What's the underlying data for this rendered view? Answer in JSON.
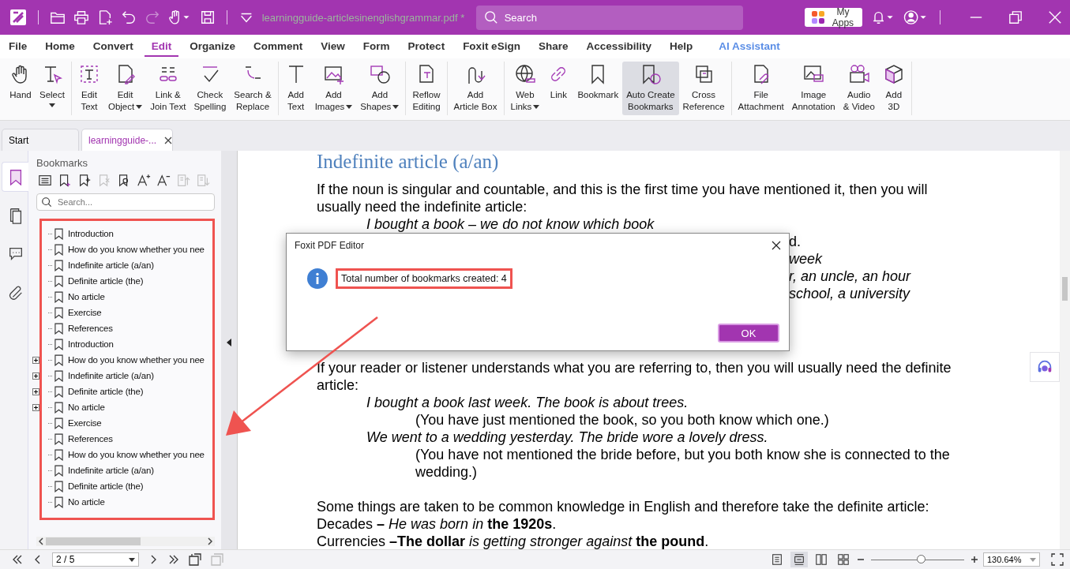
{
  "window": {
    "title": "learningguide-articlesinenglishgrammar.pdf *",
    "search_placeholder": "Search",
    "my_apps": "My Apps"
  },
  "menu": [
    {
      "label": "File",
      "selected": false
    },
    {
      "label": "Home",
      "selected": false
    },
    {
      "label": "Convert",
      "selected": false
    },
    {
      "label": "Edit",
      "selected": true
    },
    {
      "label": "Organize",
      "selected": false
    },
    {
      "label": "Comment",
      "selected": false
    },
    {
      "label": "View",
      "selected": false
    },
    {
      "label": "Form",
      "selected": false
    },
    {
      "label": "Protect",
      "selected": false
    },
    {
      "label": "Foxit eSign",
      "selected": false
    },
    {
      "label": "Share",
      "selected": false
    },
    {
      "label": "Accessibility",
      "selected": false
    },
    {
      "label": "Help",
      "selected": false
    },
    {
      "label": "AI Assistant",
      "selected": false,
      "kind": "ai"
    }
  ],
  "ribbon_groups": [
    [
      {
        "lines": [
          "Hand"
        ],
        "dropdown": false,
        "selected": false
      },
      {
        "lines": [
          "Select"
        ],
        "dropdown": true,
        "selected": false
      }
    ],
    [
      {
        "lines": [
          "Edit",
          "Text"
        ],
        "dropdown": false,
        "selected": false
      },
      {
        "lines": [
          "Edit",
          "Object"
        ],
        "dropdown": true,
        "selected": false
      },
      {
        "lines": [
          "Link &",
          "Join Text"
        ],
        "dropdown": false,
        "selected": false
      },
      {
        "lines": [
          "Check",
          "Spelling"
        ],
        "dropdown": false,
        "selected": false
      },
      {
        "lines": [
          "Search &",
          "Replace"
        ],
        "dropdown": false,
        "selected": false
      }
    ],
    [
      {
        "lines": [
          "Add",
          "Text"
        ],
        "dropdown": false,
        "selected": false
      },
      {
        "lines": [
          "Add",
          "Images"
        ],
        "dropdown": true,
        "selected": false
      },
      {
        "lines": [
          "Add",
          "Shapes"
        ],
        "dropdown": true,
        "selected": false
      }
    ],
    [
      {
        "lines": [
          "Reflow",
          "Editing"
        ],
        "dropdown": false,
        "selected": false
      }
    ],
    [
      {
        "lines": [
          "Add",
          "Article Box"
        ],
        "dropdown": false,
        "selected": false
      }
    ],
    [
      {
        "lines": [
          "Web",
          "Links"
        ],
        "dropdown": true,
        "selected": false
      },
      {
        "lines": [
          "Link"
        ],
        "dropdown": false,
        "selected": false
      },
      {
        "lines": [
          "Bookmark"
        ],
        "dropdown": false,
        "selected": false
      },
      {
        "lines": [
          "Auto Create",
          "Bookmarks"
        ],
        "dropdown": false,
        "selected": true
      },
      {
        "lines": [
          "Cross",
          "Reference"
        ],
        "dropdown": false,
        "selected": false
      }
    ],
    [
      {
        "lines": [
          "File",
          "Attachment"
        ],
        "dropdown": false,
        "selected": false
      },
      {
        "lines": [
          "Image",
          "Annotation"
        ],
        "dropdown": false,
        "selected": false
      },
      {
        "lines": [
          "Audio",
          "& Video"
        ],
        "dropdown": false,
        "selected": false
      },
      {
        "lines": [
          "Add",
          "3D"
        ],
        "dropdown": false,
        "selected": false
      }
    ]
  ],
  "doc_tabs": [
    {
      "label": "Start",
      "selected": false
    },
    {
      "label": "learningguide-...",
      "selected": true
    }
  ],
  "rail": [
    {
      "selected": true
    },
    {
      "selected": false
    },
    {
      "selected": false
    },
    {
      "selected": false
    }
  ],
  "bookmarks": {
    "title": "Bookmarks",
    "search_placeholder": "Search...",
    "tools": [
      {
        "disabled": false
      },
      {
        "disabled": false
      },
      {
        "disabled": false
      },
      {
        "disabled": true
      },
      {
        "disabled": false
      },
      {
        "disabled": false
      },
      {
        "disabled": false
      },
      {
        "disabled": true
      },
      {
        "disabled": true
      }
    ],
    "items": [
      {
        "label": "Introduction",
        "expandable": false
      },
      {
        "label": "How do you know whether you nee",
        "expandable": false
      },
      {
        "label": "Indefinite article (a/an)",
        "expandable": false
      },
      {
        "label": "Definite article (the)",
        "expandable": false
      },
      {
        "label": "No article",
        "expandable": false
      },
      {
        "label": "Exercise",
        "expandable": false
      },
      {
        "label": "References",
        "expandable": false
      },
      {
        "label": "Introduction",
        "expandable": false
      },
      {
        "label": "How do you know whether you nee",
        "expandable": true
      },
      {
        "label": "Indefinite article (a/an)",
        "expandable": true
      },
      {
        "label": "Definite article (the)",
        "expandable": true
      },
      {
        "label": "No article",
        "expandable": true
      },
      {
        "label": "Exercise",
        "expandable": false
      },
      {
        "label": "References",
        "expandable": false
      },
      {
        "label": "How do you know whether you nee",
        "expandable": false
      },
      {
        "label": "Indefinite article (a/an)",
        "expandable": false
      },
      {
        "label": "Definite article (the)",
        "expandable": false
      },
      {
        "label": "No article",
        "expandable": false
      }
    ]
  },
  "document": {
    "heading": "Indefinite article (a/an)",
    "intro": "If the noun is singular and countable, and this is the first time you have mentioned it, then you will usually need the indefinite article:",
    "intro_example": "I bought a book – we do not know which book",
    "fragments": [
      {
        "text": "d.",
        "italic": false
      },
      {
        "text": "week",
        "italic": true
      },
      {
        "text": "r, an uncle, an hour",
        "italic": true
      },
      {
        "text": "school, a university",
        "italic": true
      }
    ],
    "definite": "If your reader or listener understands what you are referring to, then you will usually need the definite article:",
    "examples": [
      {
        "text": "I bought a book last week. The book is about trees.",
        "children": [
          {
            "text": "(You have just mentioned the book, so you both know which one.)"
          }
        ]
      },
      {
        "text": "We went to a wedding yesterday. The bride wore a lovely dress.",
        "children": [
          {
            "text": "(You have not mentioned the bride before, but you both know she is connected to the wedding.)"
          }
        ]
      }
    ],
    "common": "Some things are taken to be common knowledge in English and therefore take the definite article:",
    "common_lines": [
      "Decades **–** *He was born in* **the 1920s**.",
      "Currencies **–The dollar** *is getting stronger against* **the pound**."
    ]
  },
  "dialog": {
    "title": "Foxit PDF Editor",
    "message": "Total number of bookmarks created: 4",
    "button": "OK"
  },
  "status_bar": {
    "page": "2 / 5",
    "views": [
      {
        "selected": false
      },
      {
        "selected": true
      },
      {
        "selected": false
      },
      {
        "selected": false
      }
    ],
    "zoom": {
      "level": 0.54,
      "value": "130.64%"
    }
  }
}
